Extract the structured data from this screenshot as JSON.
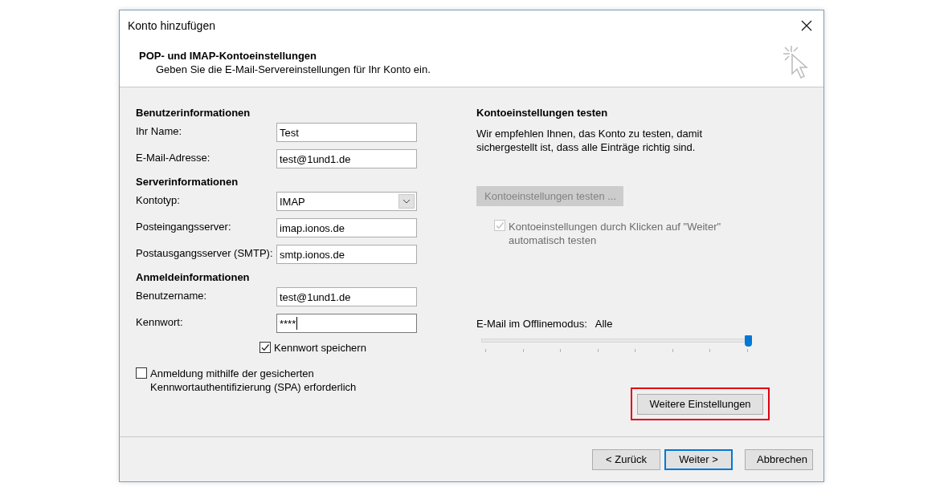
{
  "window": {
    "title": "Konto hinzufügen"
  },
  "header": {
    "title": "POP- und IMAP-Kontoeinstellungen",
    "subtitle": "Geben Sie die E-Mail-Servereinstellungen für Ihr Konto ein."
  },
  "left_sections": [
    {
      "heading": "Benutzerinformationen",
      "fields": [
        {
          "label": "Ihr Name:",
          "kind": "text",
          "value": "Test",
          "focused": false
        },
        {
          "label": "E-Mail-Adresse:",
          "kind": "text",
          "value": "test@1und1.de",
          "focused": false
        }
      ]
    },
    {
      "heading": "Serverinformationen",
      "fields": [
        {
          "label": "Kontotyp:",
          "kind": "dropdown",
          "value": "IMAP",
          "focused": false
        },
        {
          "label": "Posteingangsserver:",
          "kind": "text",
          "value": "imap.ionos.de",
          "focused": false
        },
        {
          "label": "Postausgangsserver (SMTP):",
          "kind": "text",
          "value": "smtp.ionos.de",
          "focused": false
        }
      ]
    },
    {
      "heading": "Anmeldeinformationen",
      "fields": [
        {
          "label": "Benutzername:",
          "kind": "text",
          "value": "test@1und1.de",
          "focused": false
        },
        {
          "label": "Kennwort:",
          "kind": "password",
          "value": "****",
          "focused": true
        }
      ]
    }
  ],
  "save_password": {
    "label": "Kennwort speichern",
    "checked": true
  },
  "spa": {
    "label": "Anmeldung mithilfe der gesicherten\nKennwortauthentifizierung (SPA) erforderlich",
    "checked": false
  },
  "test_section": {
    "heading": "Kontoeinstellungen testen",
    "text": "Wir empfehlen Ihnen, das Konto zu testen, damit\nsichergestellt ist, dass alle Einträge richtig sind.",
    "button": {
      "label": "Kontoeinstellungen testen ...",
      "disabled": true
    },
    "auto_test": {
      "label": "Kontoeinstellungen durch Klicken auf \"Weiter\"\nautomatisch testen",
      "checked": true,
      "disabled": true
    }
  },
  "offline": {
    "label": "E-Mail im Offlinemodus:",
    "value": "Alle",
    "level": 1
  },
  "more_settings": {
    "label": "Weitere Einstellungen",
    "highlighted": true
  },
  "buttons": [
    {
      "label": "< Zurück",
      "default": false
    },
    {
      "label": "Weiter >",
      "default": true
    },
    {
      "label": "Abbrechen",
      "default": false
    }
  ]
}
